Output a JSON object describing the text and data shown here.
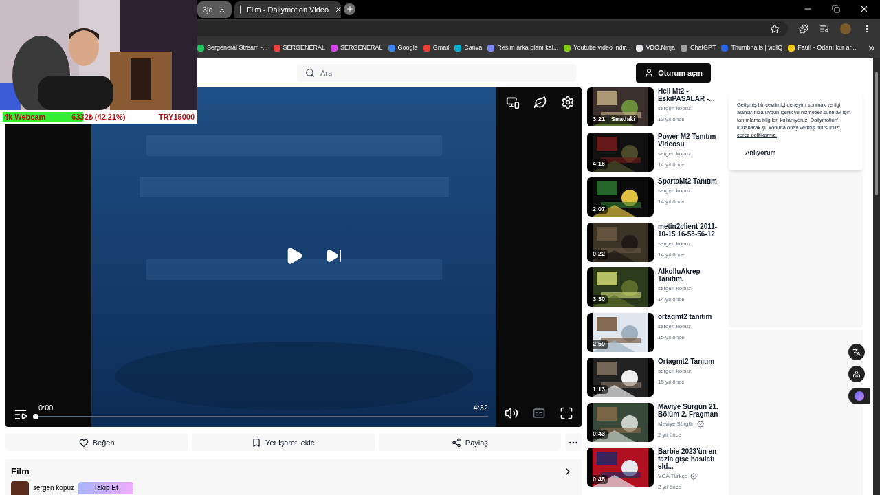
{
  "browser": {
    "tabs": [
      {
        "title": "3jc",
        "selected": false
      },
      {
        "title": "Film - Dailymotion Video",
        "selected": true
      }
    ],
    "bookmarks": [
      {
        "title": "Sergeneral Stream -...",
        "color": "#22c55e"
      },
      {
        "title": "SERGENERAL",
        "color": "#ef4444"
      },
      {
        "title": "SERGENERAL",
        "color": "#d946ef"
      },
      {
        "title": "Google",
        "color": "#4285f4"
      },
      {
        "title": "Gmail",
        "color": "#ea4335"
      },
      {
        "title": "Canva",
        "color": "#06b6d4"
      },
      {
        "title": "Resim arka planı kal...",
        "color": "#818cf8"
      },
      {
        "title": "Youtube video indir...",
        "color": "#84cc16"
      },
      {
        "title": "VDO.Ninja",
        "color": "#e5e7eb"
      },
      {
        "title": "ChatGPT",
        "color": "#a3a3a3"
      },
      {
        "title": "Thumbnails | vidIQ",
        "color": "#2563eb"
      },
      {
        "title": "Faul! - Odanı kur ar...",
        "color": "#facc15"
      }
    ]
  },
  "webcam_overlay": {
    "label": "4k Webcam",
    "amount": "6332₺ (42.21%)",
    "goal": "TRY15000",
    "level": 0.42
  },
  "search": {
    "placeholder": "Ara"
  },
  "login_button": "Oturum açın",
  "player": {
    "current_time": "0:00",
    "duration": "4:32",
    "level": 0
  },
  "actions": [
    {
      "kind": "like",
      "label": "Beğen"
    },
    {
      "kind": "bookmark",
      "label": "Yer işareti ekle"
    },
    {
      "kind": "share",
      "label": "Paylaş"
    },
    {
      "kind": "more"
    }
  ],
  "channel": {
    "title": "Film",
    "name": "sergen kopuz",
    "follow": "Takip Et"
  },
  "videos": [
    {
      "title": "Hell Mt2 - EskiPASALAR -...",
      "channel": "sergen kopuz",
      "age": "13 yıl önce",
      "duration": "3:21",
      "next": "Sıradaki",
      "verified": false
    },
    {
      "title": "Power M2 Tanıtım Videosu",
      "channel": "sergen kopuz",
      "age": "14 yıl önce",
      "duration": "4:16",
      "verified": false
    },
    {
      "title": "SpartaMt2 Tanıtım",
      "channel": "sergen kopuz",
      "age": "14 yıl önce",
      "duration": "2:07",
      "verified": false
    },
    {
      "title": "metin2client 2011-10-15 16-53-56-12",
      "channel": "sergen kopuz",
      "age": "14 yıl önce",
      "duration": "0:22",
      "verified": false
    },
    {
      "title": "AlkolluAkrep Tanıtım.",
      "channel": "sergen kopuz",
      "age": "14 yıl önce",
      "duration": "3:30",
      "verified": false
    },
    {
      "title": "ortagmt2 tanıtım",
      "channel": "sergen kopuz",
      "age": "15 yıl önce",
      "duration": "2:59",
      "verified": false
    },
    {
      "title": "Ortagmt2 Tanıtım",
      "channel": "sergen kopuz",
      "age": "15 yıl önce",
      "duration": "1:13",
      "verified": false
    },
    {
      "title": "Maviye Sürgün 21. Bölüm 2. Fragman",
      "channel": "Maviye Sürgün",
      "age": "2 yıl önce",
      "duration": "0:43",
      "verified": true
    },
    {
      "title": "Barbie 2023'ün en fazla gişe hasılatı eld...",
      "channel": "VOA Türkçe",
      "age": "2 yıl önce",
      "duration": "0:45",
      "verified": true
    }
  ],
  "cookie": {
    "text": "Gelişmiş bir çevrimiçi deneyim sunmak ve ilgi alanlarınıza uygun içerik ve hizmetler sunmak için tanımlama bilgileri kullanıyoruz. Dailymotion'ı kullanarak şu konuda onay vermiş olursunuz:",
    "link": "çerez politikamız.",
    "button": "Anlıyorum"
  }
}
